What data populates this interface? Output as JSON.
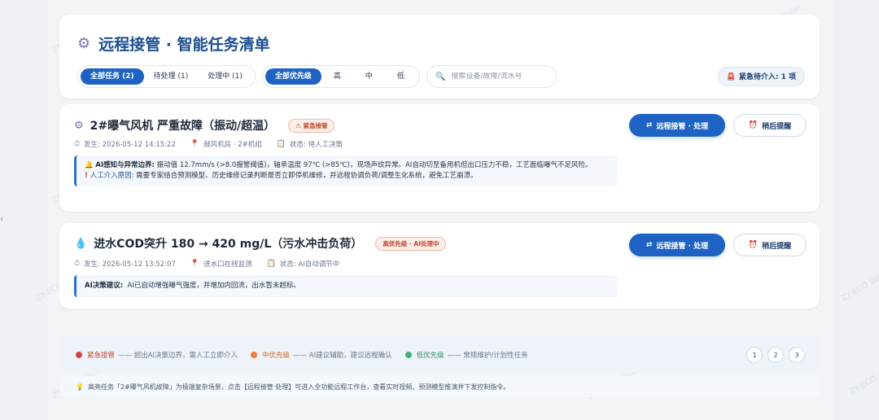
{
  "header": {
    "title": "远程接管 · 智能任务清单",
    "status_tabs": [
      "全部任务 (2)",
      "待处理 (1)",
      "处理中 (1)"
    ],
    "priority_tabs": [
      "全部优先级",
      "高",
      "中",
      "低"
    ],
    "search": {
      "placeholder": "搜索设备/故障/流水号",
      "value": ""
    },
    "urgent_summary": "紧急待介入: 1 项"
  },
  "tasks": [
    {
      "title": "2#曝气风机 严重故障（振动/超温）",
      "tag": "紧急接管",
      "meta": {
        "time": "发生: 2026-05-12 14:15:22",
        "location": "鼓风机房 · 2#机组",
        "status": "状态: 待人工决策"
      },
      "info": {
        "label1": "AI感知与异常边界:",
        "text1": "振动值 12.7mm/s (>8.0报警阈值)，轴承温度 97℃ (>85℃)，现场声纹异常。AI自动切至备用机但出口压力不稳，工艺面临曝气不足风险。",
        "label2": "人工介入原因:",
        "text2": "需要专家结合预测模型、历史维修记录判断是否立即停机维修，并远程协调负荷/调整生化系统，避免工艺崩溃。"
      },
      "primary_action": "远程接管 · 处理",
      "secondary_action": "稍后提醒"
    },
    {
      "title": "进水COD突升 180 → 420 mg/L（污水冲击负荷）",
      "tag": "高优先级 · AI处理中",
      "meta": {
        "time": "发生: 2026-05-12 13:52:07",
        "location": "进水口在线监测",
        "status": "状态: AI自动调节中"
      },
      "info": {
        "label1": "AI决策建议:",
        "text1": "AI已自动增强曝气强度，并增加内回流，出水暂未超标。"
      },
      "primary_action": "远程接管 · 处理",
      "secondary_action": "稍后提醒"
    }
  ],
  "legend": [
    {
      "label": "紧急接管",
      "desc": "—— 超出AI决策边界，需人工立即介入",
      "color": "#d94040"
    },
    {
      "label": "中优先级",
      "desc": "—— AI建议辅助，建议远程确认",
      "color": "#ee7d36"
    },
    {
      "label": "低优先级",
      "desc": "—— 常规维护/计划性任务",
      "color": "#3cb371"
    }
  ],
  "pagination": [
    "1",
    "2",
    "3"
  ],
  "tip": "高亮任务「2#曝气风机故障」为极端复杂场景，点击【远程接管·处理】可进入全功能远程工作台，查看实时视频、预测模型推演并下发控制指令。",
  "watermark": "ZY-ECO Water",
  "colors": {
    "primary": "#1e63c4",
    "title": "#1d4f91",
    "urgent": "#c2442a"
  },
  "icons": {
    "title": "gear-icon",
    "search": "search-icon",
    "siren": "siren-icon",
    "task1": "gear-icon",
    "task2": "droplet-icon",
    "time": "stopwatch-icon",
    "location": "pin-icon",
    "status": "clipboard-icon",
    "alert": "bell-icon",
    "exclaim": "exclamation-icon",
    "alarm": "alarm-clock-icon",
    "tip": "lightbulb-icon"
  }
}
